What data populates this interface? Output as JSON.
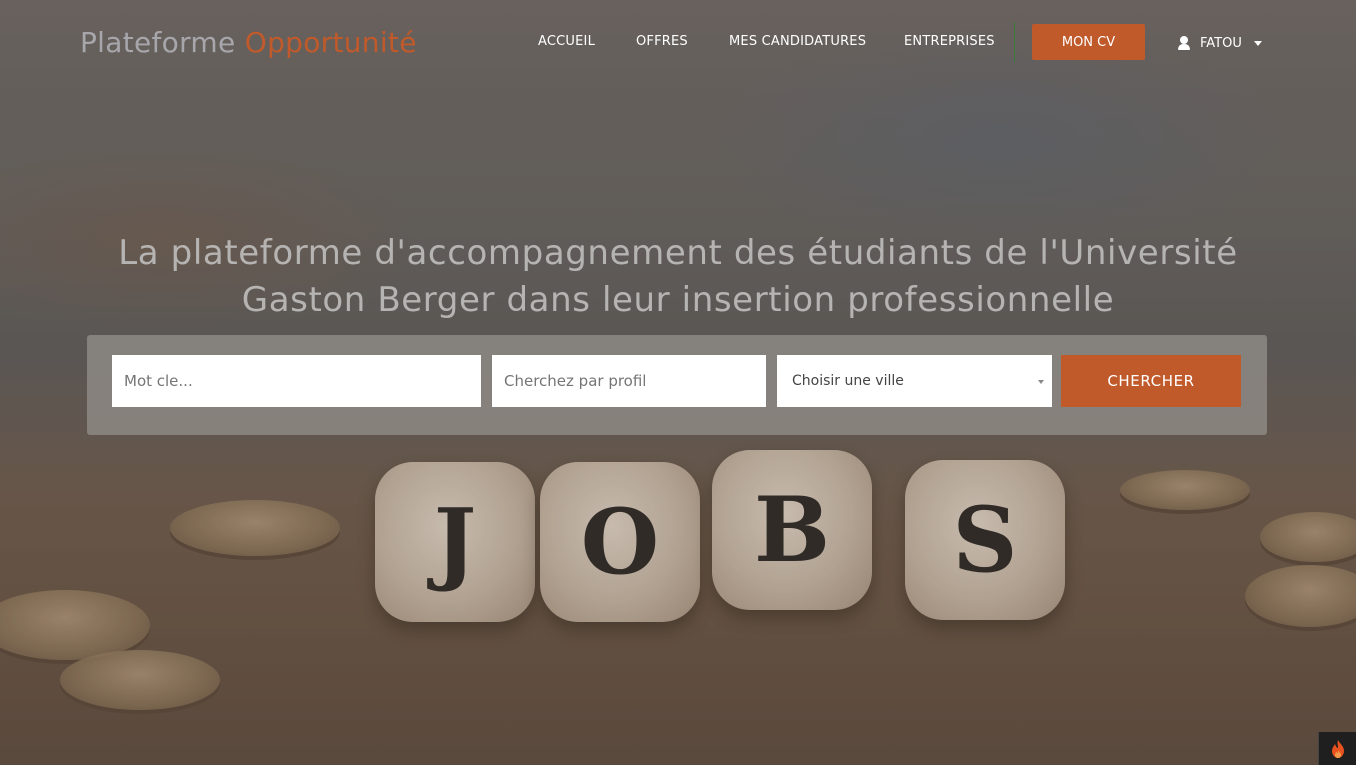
{
  "brand": {
    "part1": "Plateforme",
    "part2": "Opportunité"
  },
  "nav": {
    "items": [
      {
        "label": "ACCUEIL"
      },
      {
        "label": "OFFRES"
      },
      {
        "label": "MES CANDIDATURES"
      },
      {
        "label": "ENTREPRISES"
      }
    ],
    "cv_button": "MON CV",
    "user_name": "FATOU"
  },
  "hero": {
    "headline_line1": "La plateforme d'accompagnement des étudiants de l'Université",
    "headline_line2": "Gaston Berger dans leur insertion professionnelle",
    "dice_letters": [
      "J",
      "O",
      "B",
      "S"
    ]
  },
  "search": {
    "keyword_placeholder": "Mot cle...",
    "profile_placeholder": "Cherchez par profil",
    "city_selected": "Choisir une ville",
    "button": "CHERCHER"
  },
  "colors": {
    "accent": "#c05a2b",
    "brand_gray": "#a6a6ab"
  },
  "icons": {
    "user": "user-icon",
    "caret": "caret-down-icon",
    "corner": "flame-icon"
  }
}
